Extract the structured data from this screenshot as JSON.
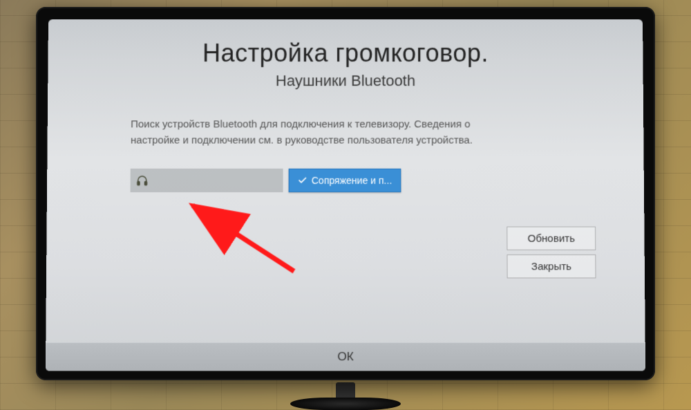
{
  "header": {
    "title": "Настройка громкоговор.",
    "subtitle": "Наушники Bluetooth"
  },
  "description": "Поиск устройств Bluetooth для подключения к телевизору. Сведения о настройке и подключении см. в руководстве пользователя устройства.",
  "device": {
    "name": " ",
    "pair_label": "Сопряжение и п..."
  },
  "buttons": {
    "refresh": "Обновить",
    "close": "Закрыть",
    "ok": "ОК"
  }
}
